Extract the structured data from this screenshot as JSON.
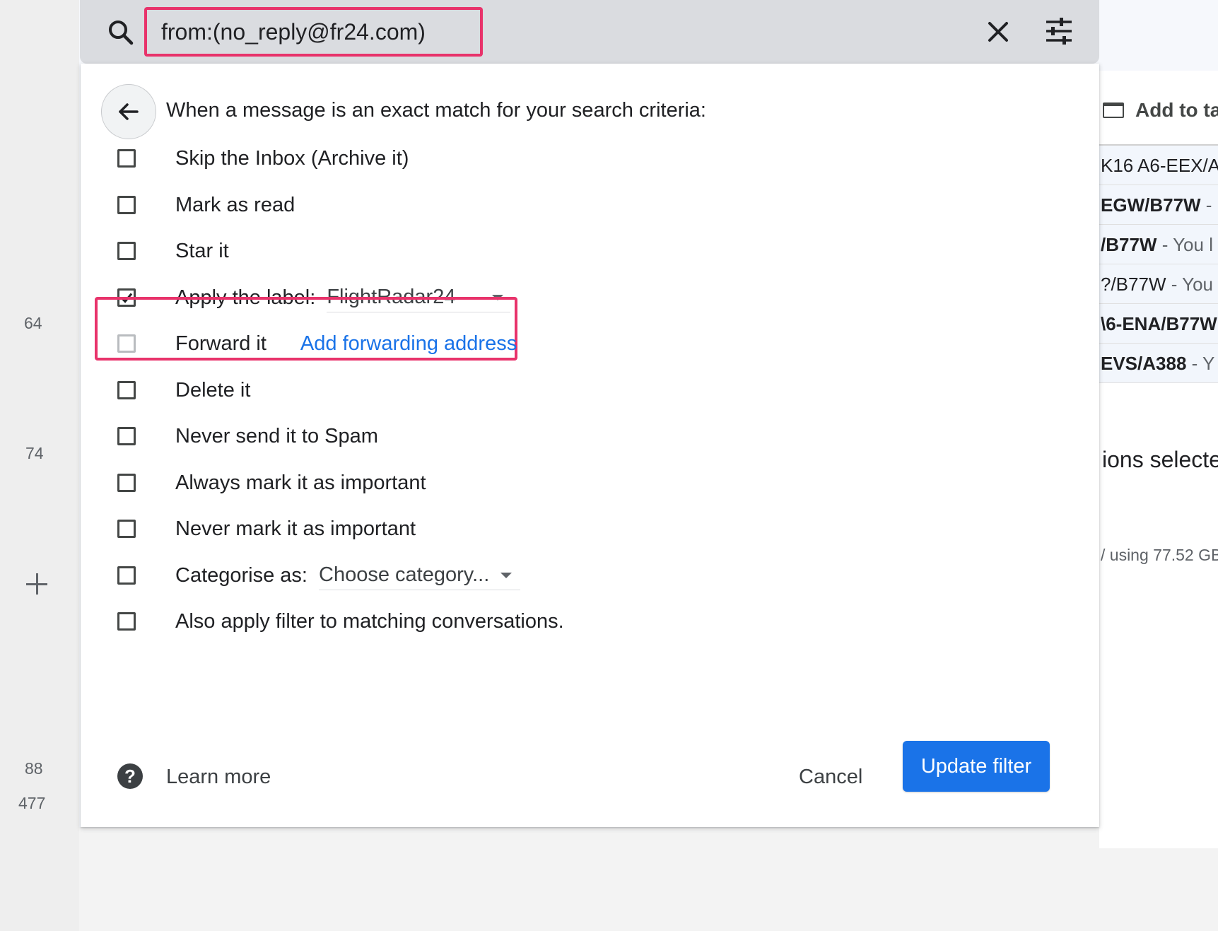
{
  "left_rail": {
    "counts": [
      "64",
      "74",
      "88",
      "477"
    ]
  },
  "search": {
    "query": "from:(no_reply@fr24.com)"
  },
  "filter": {
    "intro": "When a message is an exact match for your search criteria:",
    "options": [
      {
        "label": "Skip the Inbox (Archive it)",
        "checked": false
      },
      {
        "label": "Mark as read",
        "checked": false
      },
      {
        "label": "Star it",
        "checked": false
      },
      {
        "label": "Apply the label:",
        "checked": true,
        "selected": "FlightRadar24"
      },
      {
        "label": "Forward it",
        "checked": false,
        "disabled": true,
        "link": "Add forwarding address"
      },
      {
        "label": "Delete it",
        "checked": false
      },
      {
        "label": "Never send it to Spam",
        "checked": false
      },
      {
        "label": "Always mark it as important",
        "checked": false
      },
      {
        "label": "Never mark it as important",
        "checked": false
      },
      {
        "label": "Categorise as:",
        "checked": false,
        "selected": "Choose category..."
      },
      {
        "label": "Also apply filter to matching conversations.",
        "checked": false
      }
    ],
    "learn_more": "Learn more",
    "cancel": "Cancel",
    "update": "Update filter"
  },
  "background": {
    "add_to_tasks": "Add to ta",
    "rows": [
      {
        "subject": "K16 A6-EEX/A",
        "snippet": ""
      },
      {
        "subject": "EGW/B77W",
        "snippet": " -"
      },
      {
        "subject": "/B77W",
        "snippet": " - You l"
      },
      {
        "subject": "?/B77W",
        "snippet": " - You"
      },
      {
        "subject": "\\6-ENA/B77W",
        "snippet": ""
      },
      {
        "subject": "EVS/A388",
        "snippet": " - Y"
      }
    ],
    "selected_text": "ions selecte",
    "storage_text": "/ using 77.52 GB"
  },
  "colors": {
    "accent": "#1a73e8",
    "highlight": "#e8336b"
  },
  "icons": {
    "search": "search-icon",
    "clear": "close-icon",
    "options": "tune-icon",
    "back": "arrow-back-icon",
    "help": "help-icon"
  }
}
